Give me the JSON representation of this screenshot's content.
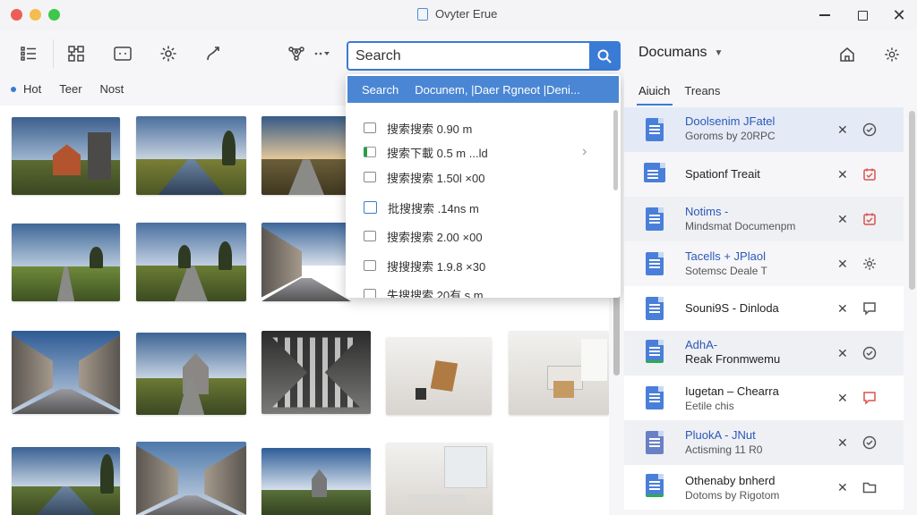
{
  "window": {
    "title": "Ovyter Erue"
  },
  "toolbar": {
    "icons": [
      "list-icon",
      "grid-select-icon",
      "frame-icon",
      "settings-icon",
      "route-icon",
      "network-icon",
      "more-dropdown-icon"
    ]
  },
  "search": {
    "value": "Search",
    "button_icon": "search-icon"
  },
  "filters": {
    "items": [
      "Hot",
      "Teer",
      "Nost"
    ],
    "active_color": "#3a7bd5"
  },
  "dropdown": {
    "header_label": "Search",
    "header_text": "Docunem, |Daer Rgneot |Deni...",
    "items": [
      {
        "icon": "file-icon",
        "text": "搜索搜索 0.90 m"
      },
      {
        "icon": "file-green-icon",
        "text": "搜索下載 0.5 m ...ld"
      },
      {
        "icon": "file-icon",
        "text": "搜索搜索 1.50l ×00"
      },
      {
        "icon": "file-blue-icon",
        "text": "批搜搜索 .14ns m"
      },
      {
        "icon": "file-icon",
        "text": "搜索搜索 2.00 ×00"
      },
      {
        "icon": "file-icon",
        "text": "搜搜搜索 1.9.8 ×30"
      },
      {
        "icon": "file-icon",
        "text": "失搜搜索 20有 s m"
      }
    ]
  },
  "panel": {
    "title": "Documans",
    "tabs": [
      "Aiuich",
      "Treans"
    ],
    "rows": [
      {
        "name": "Doolsenim JFatel",
        "sub": "Goroms by 20RPC",
        "action": "clock-check-icon",
        "action_color": "#555"
      },
      {
        "name": "Spationf Treait",
        "sub": "",
        "action": "calendar-icon",
        "action_color": "#d9534f"
      },
      {
        "name": "Notims -",
        "sub": "Mindsmat Documenpm",
        "action": "calendar-icon",
        "action_color": "#d9534f"
      },
      {
        "name": "Tacells + JPlaol",
        "sub": "Sotemsc Deale T",
        "action": "gear-icon",
        "action_color": "#555"
      },
      {
        "name": "Souni9S - Dinloda",
        "sub": "",
        "action": "chat-icon",
        "action_color": "#555"
      },
      {
        "name": "AdhA-",
        "sub": "Reak Fronmwemu",
        "action": "clock-check-icon",
        "action_color": "#555"
      },
      {
        "name": "Iugetan – Chearra",
        "sub": "Eetile chis",
        "action": "chat-icon",
        "action_color": "#d9534f"
      },
      {
        "name": "PluokA - JNut",
        "sub": "Actisming 11 R0",
        "action": "clock-check-icon",
        "action_color": "#555"
      },
      {
        "name": "Othenaby bnherd",
        "sub": "Dotoms by Rigotom",
        "action": "folder-icon",
        "action_color": "#555"
      }
    ],
    "close_symbol": "✕"
  }
}
